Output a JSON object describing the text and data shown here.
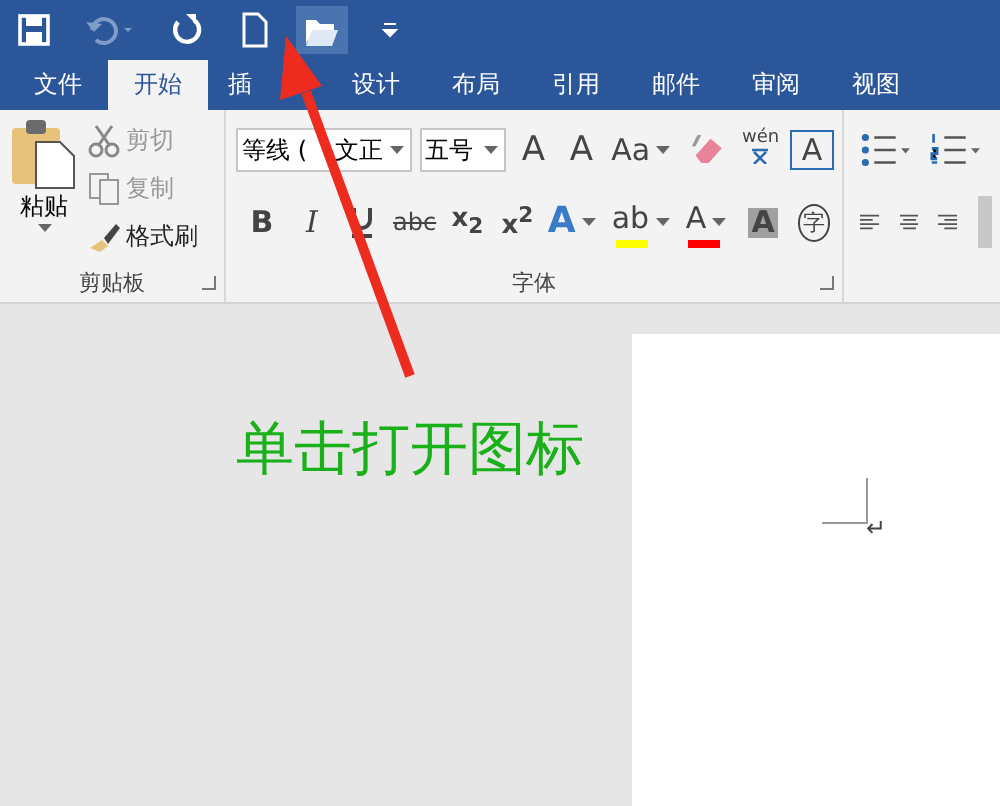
{
  "quick_access": [
    {
      "kind": "save",
      "highlighted": false
    },
    {
      "kind": "undo",
      "highlighted": false
    },
    {
      "kind": "redo",
      "highlighted": false
    },
    {
      "kind": "new",
      "highlighted": false
    },
    {
      "kind": "open",
      "highlighted": true
    },
    {
      "kind": "customize",
      "highlighted": false
    }
  ],
  "tabs": [
    {
      "label": "文件",
      "selected": false
    },
    {
      "label": "开始",
      "selected": true
    },
    {
      "label": "插",
      "selected": false
    },
    {
      "label": "设计",
      "selected": false
    },
    {
      "label": "布局",
      "selected": false
    },
    {
      "label": "引用",
      "selected": false
    },
    {
      "label": "邮件",
      "selected": false
    },
    {
      "label": "审阅",
      "selected": false
    },
    {
      "label": "视图",
      "selected": false
    }
  ],
  "clipboard": {
    "paste": "粘贴",
    "items": [
      {
        "kind": "cut",
        "label": "剪切",
        "disabled": true
      },
      {
        "kind": "copy",
        "label": "复制",
        "disabled": true
      },
      {
        "kind": "painter",
        "label": "格式刷",
        "disabled": false
      }
    ],
    "group_label": "剪贴板"
  },
  "font": {
    "font_name": [
      "等线 (",
      "文正"
    ],
    "font_size": "五号",
    "row1": [
      {
        "kind": "grow",
        "label": "A"
      },
      {
        "kind": "shrink",
        "label": "A"
      },
      {
        "kind": "case",
        "label": "Aa"
      },
      {
        "kind": "eraser"
      },
      {
        "kind": "phonetic",
        "label": "wén"
      },
      {
        "kind": "boxed",
        "label": "A"
      }
    ],
    "row2": [
      {
        "kind": "bold",
        "label": "B"
      },
      {
        "kind": "italic",
        "label": "I"
      },
      {
        "kind": "underline"
      },
      {
        "kind": "strike",
        "label": "abc"
      },
      {
        "kind": "sub",
        "label": "x$_{2}$"
      },
      {
        "kind": "sup",
        "label": "x$^{2}$"
      },
      {
        "kind": "effect",
        "label": "A"
      },
      {
        "kind": "highlight",
        "label": "ab",
        "color": "#ffff00"
      },
      {
        "kind": "fontcolor",
        "label": "A",
        "color": "#ff0000"
      },
      {
        "kind": "shade",
        "label": "A"
      },
      {
        "kind": "enclose",
        "label": "字"
      }
    ],
    "group_label": "字体"
  },
  "annotation": "单击打开图标",
  "document": {
    "paragraph_mark": "↵"
  }
}
